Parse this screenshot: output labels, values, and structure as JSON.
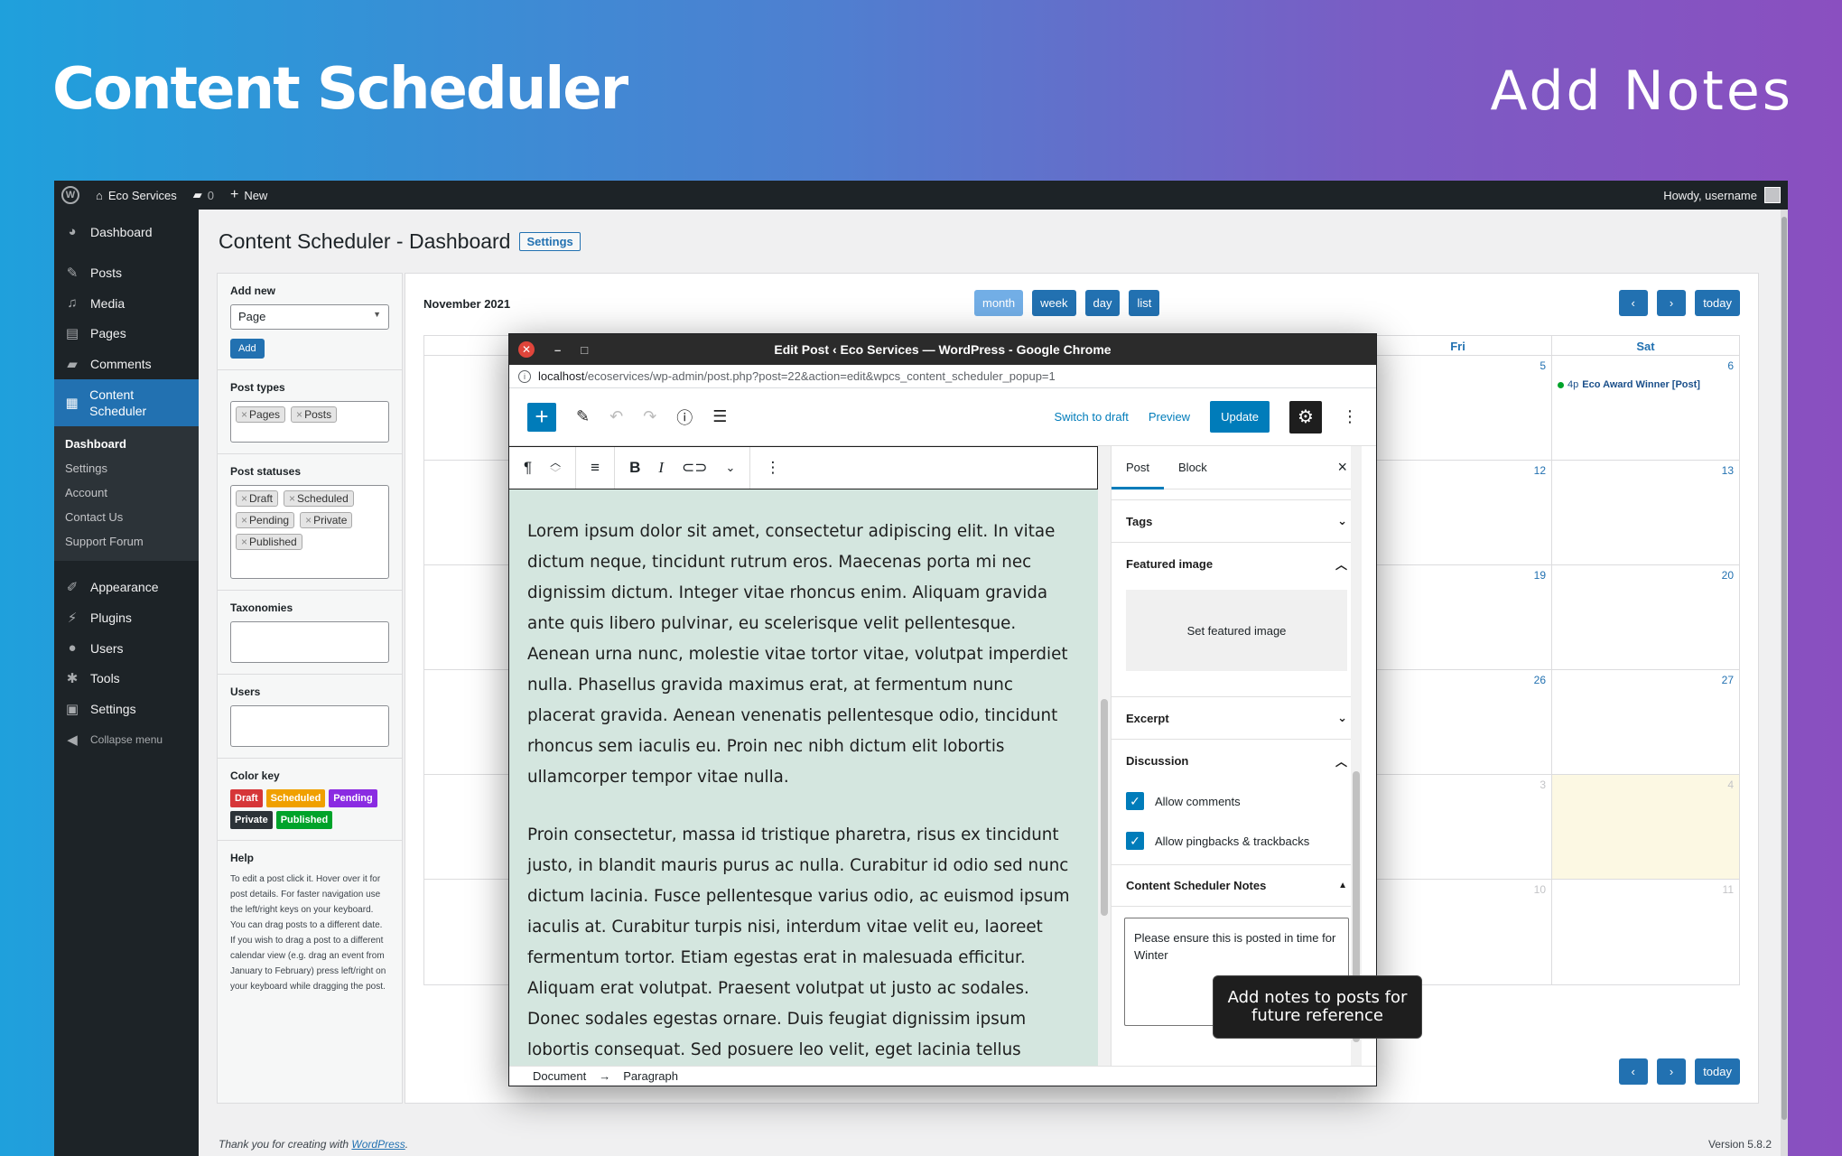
{
  "hero": {
    "title": "Content Scheduler",
    "subtitle": "Add Notes"
  },
  "adminbar": {
    "site": "Eco Services",
    "comments": "0",
    "new": "New",
    "howdy": "Howdy, username"
  },
  "sidebar": {
    "items": [
      {
        "label": "Dashboard",
        "icon": "dashboard-icon"
      },
      {
        "label": "Posts",
        "icon": "pin-icon"
      },
      {
        "label": "Media",
        "icon": "media-icon"
      },
      {
        "label": "Pages",
        "icon": "pages-icon"
      },
      {
        "label": "Comments",
        "icon": "comment-icon"
      },
      {
        "label": "Content Scheduler",
        "icon": "calendar-icon"
      }
    ],
    "submenu": [
      "Dashboard",
      "Settings",
      "Account",
      "Contact Us",
      "Support Forum"
    ],
    "items2": [
      {
        "label": "Appearance"
      },
      {
        "label": "Plugins"
      },
      {
        "label": "Users"
      },
      {
        "label": "Tools"
      },
      {
        "label": "Settings"
      },
      {
        "label": "Collapse menu"
      }
    ]
  },
  "page": {
    "title": "Content Scheduler - Dashboard",
    "settings_btn": "Settings"
  },
  "filters": {
    "add_new_label": "Add new",
    "add_new_value": "Page",
    "add_btn": "Add",
    "post_types_label": "Post types",
    "post_types": [
      "Pages",
      "Posts"
    ],
    "post_statuses_label": "Post statuses",
    "post_statuses": [
      "Draft",
      "Scheduled",
      "Pending",
      "Private",
      "Published"
    ],
    "taxonomies_label": "Taxonomies",
    "users_label": "Users",
    "color_key_label": "Color key",
    "color_key": [
      {
        "label": "Draft",
        "color": "#d63638"
      },
      {
        "label": "Scheduled",
        "color": "#f0a000"
      },
      {
        "label": "Pending",
        "color": "#8a2be2"
      },
      {
        "label": "Private",
        "color": "#2c3338"
      },
      {
        "label": "Published",
        "color": "#00a32a"
      }
    ],
    "help_label": "Help",
    "help_text": "To edit a post click it. Hover over it for post details. For faster navigation use the left/right keys on your keyboard. You can drag posts to a different date. If you wish to drag a post to a different calendar view (e.g. drag an event from January to February) press left/right on your keyboard while dragging the post."
  },
  "calendar": {
    "month": "November 2021",
    "views": [
      "month",
      "week",
      "day",
      "list"
    ],
    "prev": "‹",
    "next": "›",
    "today": "today",
    "headers": [
      "",
      "",
      "",
      "",
      "",
      "Fri",
      "Sat"
    ],
    "rows": [
      [
        "",
        "",
        "",
        "",
        "",
        "5",
        "6"
      ],
      [
        "",
        "",
        "",
        "",
        "",
        "12",
        "13"
      ],
      [
        "",
        "",
        "",
        "",
        "",
        "19",
        "20"
      ],
      [
        "",
        "",
        "",
        "",
        "",
        "26",
        "27"
      ],
      [
        "",
        "",
        "",
        "",
        "",
        "3",
        "4"
      ],
      [
        "",
        "",
        "",
        "",
        "",
        "10",
        "11"
      ]
    ],
    "event": {
      "time": "4p",
      "title": "Eco Award Winner [Post]"
    }
  },
  "footer": {
    "thanks": "Thank you for creating with",
    "link": "WordPress",
    "version": "Version 5.8.2"
  },
  "popup": {
    "title": "Edit Post ‹ Eco Services — WordPress - Google Chrome",
    "url_host": "localhost",
    "url_path": "/ecoservices/wp-admin/post.php?post=22&action=edit&wpcs_content_scheduler_popup=1",
    "switch_draft": "Switch to draft",
    "preview": "Preview",
    "update": "Update",
    "paragraphs": [
      "Lorem ipsum dolor sit amet, consectetur adipiscing elit. In vitae dictum neque, tincidunt rutrum eros. Maecenas porta mi nec dignissim dictum. Integer vitae rhoncus enim. Aliquam gravida ante quis libero pulvinar, eu scelerisque velit pellentesque. Aenean urna nunc, molestie vitae tortor vitae, volutpat imperdiet nulla. Phasellus gravida maximus erat, at fermentum nunc placerat gravida. Aenean venenatis pellentesque odio, tincidunt rhoncus sem iaculis eu. Proin nec nibh dictum elit lobortis ullamcorper tempor vitae nulla.",
      "Proin consectetur, massa id tristique pharetra, risus ex tincidunt justo, in blandit mauris purus ac nulla. Curabitur id odio sed nunc dictum lacinia. Fusce pellentesque varius odio, ac euismod ipsum iaculis at. Curabitur turpis nisi, interdum vitae velit eu, laoreet fermentum tortor. Etiam egestas erat in malesuada efficitur. Aliquam erat volutpat. Praesent volutpat ut justo ac sodales. Donec sodales egestas ornare. Duis feugiat dignissim ipsum lobortis consequat. Sed posuere leo velit, eget lacinia tellus consectetur"
    ],
    "tabs": [
      "Post",
      "Block"
    ],
    "tags": "Tags",
    "featured_image": "Featured image",
    "set_featured": "Set featured image",
    "excerpt": "Excerpt",
    "discussion": "Discussion",
    "allow_comments": "Allow comments",
    "allow_pingbacks": "Allow pingbacks & trackbacks",
    "notes_title": "Content Scheduler Notes",
    "notes_value": "Please ensure this is posted in time for Winter",
    "breadcrumb": [
      "Document",
      "Paragraph"
    ]
  },
  "tooltip": "Add notes to posts for future reference"
}
